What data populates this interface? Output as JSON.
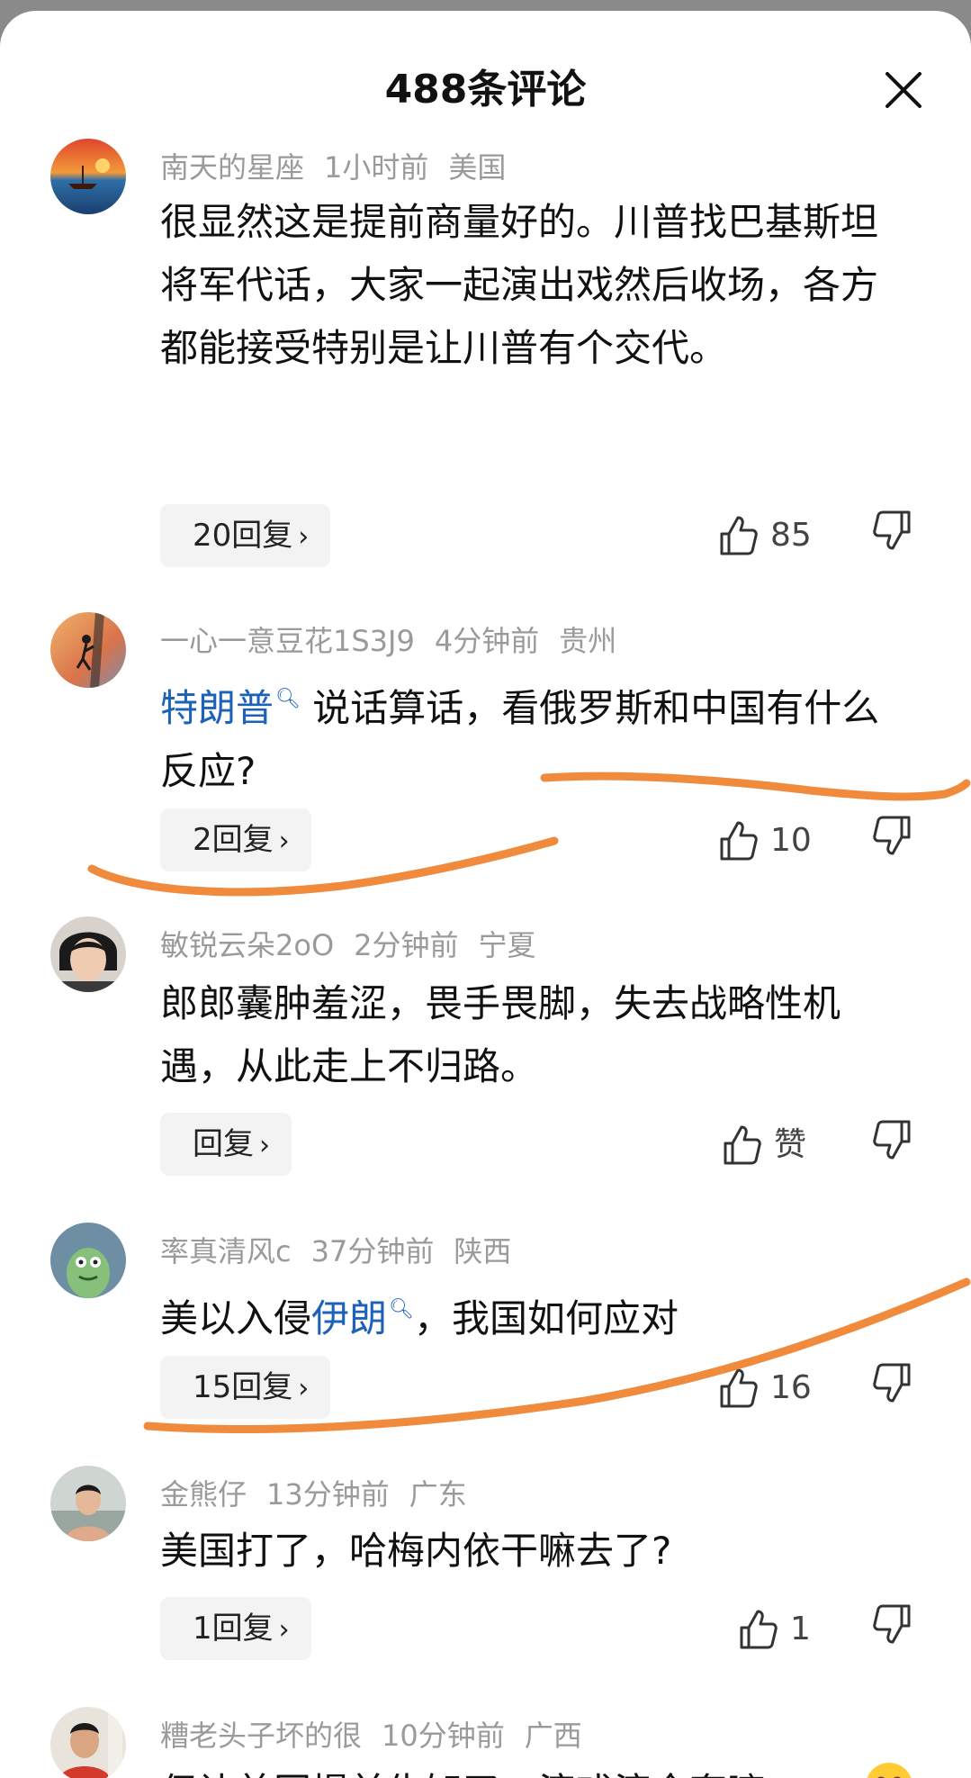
{
  "header": {
    "title": "488条评论"
  },
  "comments": [
    {
      "username": "南天的星座",
      "time": "1小时前",
      "location": "美国",
      "text_parts": [
        {
          "text": "很显然这是提前商量好的。川普找巴基斯坦将军代话，大家一起演出戏然后收场，各方都能接受特别是让川普有个交代。",
          "link": false
        }
      ],
      "reply_label": "20回复",
      "likes": "85"
    },
    {
      "username": "一心一意豆花1S3J9",
      "time": "4分钟前",
      "location": "贵州",
      "text_parts": [
        {
          "text": "特朗普",
          "link": true
        },
        {
          "text": " 说话算话，看俄罗斯和中国有什么反应?",
          "link": false
        }
      ],
      "reply_label": "2回复",
      "likes": "10"
    },
    {
      "username": "敏锐云朵2oO",
      "time": "2分钟前",
      "location": "宁夏",
      "text_parts": [
        {
          "text": "郎郎囊肿羞涩，畏手畏脚，失去战略性机遇，从此走上不归路。",
          "link": false
        }
      ],
      "reply_label": "回复",
      "likes": "赞"
    },
    {
      "username": "率真清风c",
      "time": "37分钟前",
      "location": "陕西",
      "text_parts": [
        {
          "text": "美以入侵",
          "link": false
        },
        {
          "text": "伊朗",
          "link": true
        },
        {
          "text": "，我国如何应对",
          "link": false
        }
      ],
      "reply_label": "15回复",
      "likes": "16"
    },
    {
      "username": "金熊仔",
      "time": "13分钟前",
      "location": "广东",
      "text_parts": [
        {
          "text": "美国打了，哈梅内依干嘛去了?",
          "link": false
        }
      ],
      "reply_label": "1回复",
      "likes": "1"
    },
    {
      "username": "糟老头子坏的很",
      "time": "10分钟前",
      "location": "广西",
      "text_parts": [
        {
          "text": "伊让美国提前告知了，演戏演全套嘛",
          "link": false
        }
      ]
    }
  ],
  "icons": {
    "close": "close-icon",
    "search_hint": "search-icon",
    "like": "thumbs-up-icon",
    "dislike": "thumbs-down-icon",
    "chevron": "chevron-right-icon"
  },
  "colors": {
    "link": "#1d62b8",
    "annotation": "#f08a3c",
    "meta": "#9a9a9a"
  }
}
